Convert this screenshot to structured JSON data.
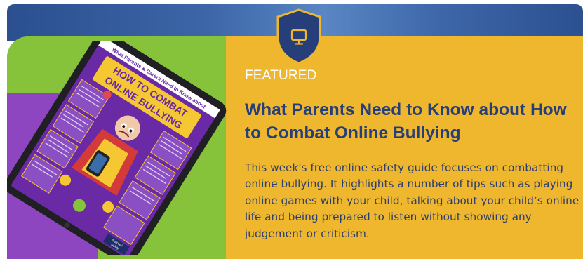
{
  "banner": {
    "badge_icon": "monitor-icon",
    "featured_label": "FEATURED",
    "title": "What Parents Need to Know about How to Combat Online Bullying",
    "description": "This week's free online safety guide focuses on combatting online bullying. It highlights a number of tips such as playing online games with your child, talking about your child’s online life and being prepared to listen without showing any judgement or criticism.",
    "colors": {
      "top_band": "#3c66a8",
      "accent_yellow": "#eeb72e",
      "title_navy": "#263e7a",
      "green": "#86c23a",
      "purple": "#8d45c0"
    }
  },
  "tablet": {
    "header_text": "What Parents & Carers Need to Know about",
    "poster_title_line1": "HOW TO COMBAT",
    "poster_title_line2": "ONLINE BULLYING",
    "logo_text_line1": "National",
    "logo_text_line2": "Online",
    "logo_text_line3": "Safety"
  }
}
